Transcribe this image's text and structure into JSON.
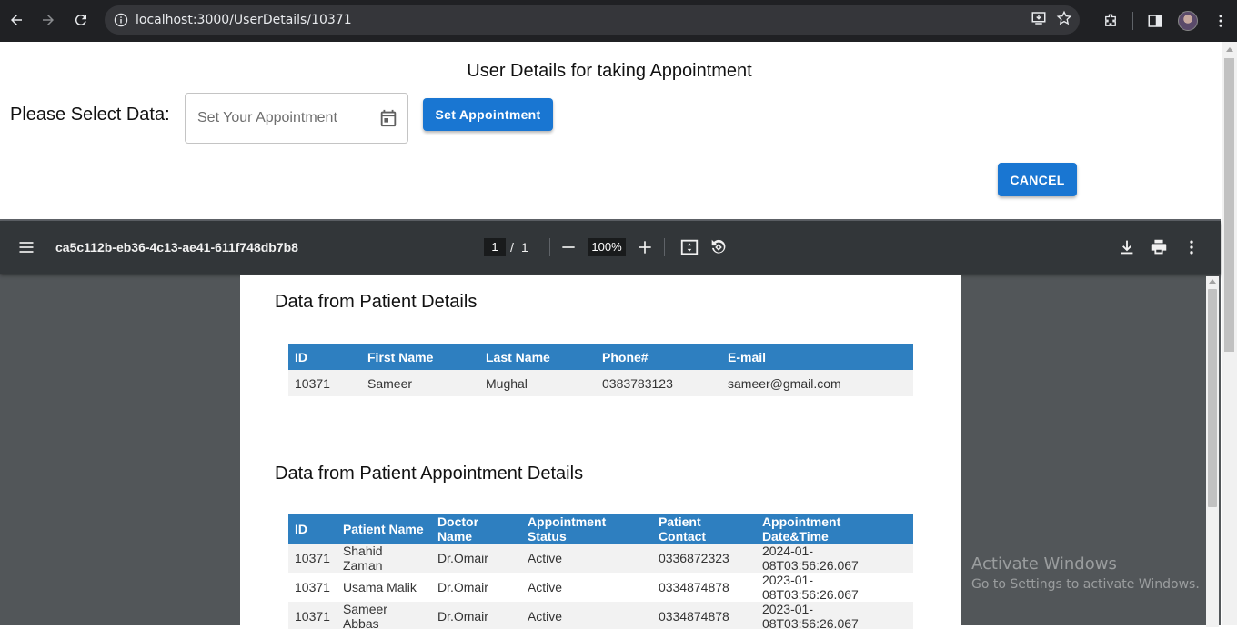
{
  "browser": {
    "url": "localhost:3000/UserDetails/10371"
  },
  "page": {
    "title": "User Details for taking Appointment",
    "select_label": "Please Select Data:",
    "date_placeholder": "Set Your Appointment",
    "set_button": "Set Appointment",
    "cancel_button": "CANCEL"
  },
  "pdf": {
    "filename": "ca5c112b-eb36-4c13-ae41-611f748db7b8",
    "current_page": "1",
    "page_sep": "/",
    "total_pages": "1",
    "zoom": "100%",
    "section1_title": "Data from Patient Details",
    "table1": {
      "headers": [
        "ID",
        "First Name",
        "Last Name",
        "Phone#",
        "E-mail"
      ],
      "rows": [
        [
          "10371",
          "Sameer",
          "Mughal",
          "0383783123",
          "sameer@gmail.com"
        ]
      ]
    },
    "section2_title": "Data from Patient Appointment Details",
    "table2": {
      "headers": [
        "ID",
        "Patient Name",
        "Doctor Name",
        "Appointment Status",
        "Patient Contact",
        "Appointment Date&Time"
      ],
      "rows": [
        [
          "10371",
          "Shahid Zaman",
          "Dr.Omair",
          "Active",
          "0336872323",
          "2024-01-08T03:56:26.067"
        ],
        [
          "10371",
          "Usama Malik",
          "Dr.Omair",
          "Active",
          "0334874878",
          "2023-01-08T03:56:26.067"
        ],
        [
          "10371",
          "Sameer Abbas",
          "Dr.Omair",
          "Active",
          "0334874878",
          "2023-01-08T03:56:26.067"
        ]
      ]
    }
  },
  "watermark": {
    "title": "Activate Windows",
    "subtitle": "Go to Settings to activate Windows."
  },
  "colors": {
    "accent": "#1976d2",
    "table_header": "#2e7fc0",
    "toolbar": "#323639"
  }
}
